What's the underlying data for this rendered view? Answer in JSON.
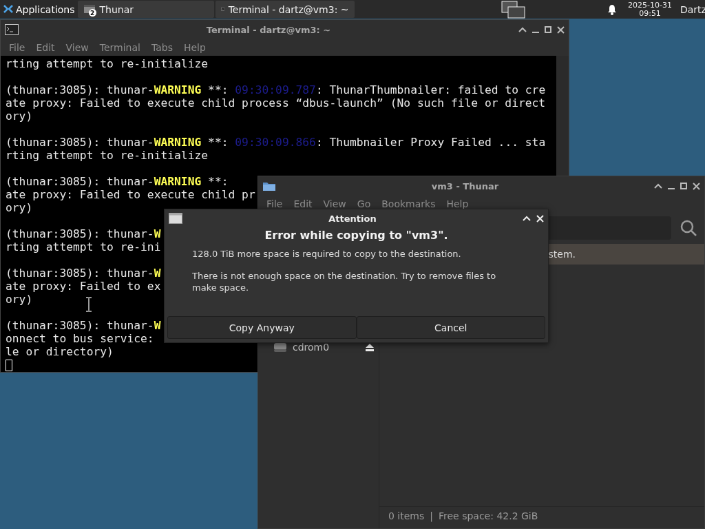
{
  "taskbar": {
    "apps_menu": "Applications",
    "tasks": [
      {
        "label": "Thunar",
        "kind": "file-manager",
        "badge": "2"
      },
      {
        "label": "Terminal - dartz@vm3: ~",
        "kind": "terminal"
      }
    ],
    "date": "2025-10-31",
    "time": "09:51",
    "user": "Dartz"
  },
  "terminal": {
    "title": "Terminal - dartz@vm3: ~",
    "menu": [
      "File",
      "Edit",
      "View",
      "Terminal",
      "Tabs",
      "Help"
    ],
    "entries": [
      {
        "lines": [
          [
            {
              "kind": "plain",
              "text": "rting attempt to re-initialize"
            }
          ]
        ]
      },
      {
        "lines": [
          [
            {
              "kind": "plain",
              "text": "(thunar:3085): thunar-"
            },
            {
              "kind": "warning",
              "text": "WARNING"
            },
            {
              "kind": "plain",
              "text": " **: "
            },
            {
              "kind": "time",
              "text": "09:30:09.787"
            },
            {
              "kind": "plain",
              "text": ": ThunarThumbnailer: failed to cre"
            }
          ],
          [
            {
              "kind": "plain",
              "text": "ate proxy: Failed to execute child process “dbus-launch” (No such file or direct"
            }
          ],
          [
            {
              "kind": "plain",
              "text": "ory)"
            }
          ]
        ]
      },
      {
        "lines": [
          [
            {
              "kind": "plain",
              "text": "(thunar:3085): thunar-"
            },
            {
              "kind": "warning",
              "text": "WARNING"
            },
            {
              "kind": "plain",
              "text": " **: "
            },
            {
              "kind": "time",
              "text": "09:30:09.866"
            },
            {
              "kind": "plain",
              "text": ": Thumbnailer Proxy Failed ... sta"
            }
          ],
          [
            {
              "kind": "plain",
              "text": "rting attempt to re-initialize"
            }
          ]
        ]
      },
      {
        "lines": [
          [
            {
              "kind": "plain",
              "text": "(thunar:3085): thunar-"
            },
            {
              "kind": "warning",
              "text": "WARNING"
            },
            {
              "kind": "plain",
              "text": " **:"
            }
          ],
          [
            {
              "kind": "plain",
              "text": "ate proxy: Failed to execute child pr"
            }
          ],
          [
            {
              "kind": "plain",
              "text": "ory)"
            }
          ]
        ]
      },
      {
        "lines": [
          [
            {
              "kind": "plain",
              "text": "(thunar:3085): thunar-"
            },
            {
              "kind": "warning",
              "text": "W"
            }
          ],
          [
            {
              "kind": "plain",
              "text": "rting attempt to re-ini"
            }
          ]
        ]
      },
      {
        "lines": [
          [
            {
              "kind": "plain",
              "text": "(thunar:3085): thunar-"
            },
            {
              "kind": "warning",
              "text": "W"
            }
          ],
          [
            {
              "kind": "plain",
              "text": "ate proxy: Failed to ex"
            }
          ],
          [
            {
              "kind": "plain",
              "text": "ory)"
            }
          ]
        ]
      },
      {
        "lines": [
          [
            {
              "kind": "plain",
              "text": "(thunar:3085): thunar-"
            },
            {
              "kind": "warning",
              "text": "W"
            }
          ],
          [
            {
              "kind": "plain",
              "text": "onnect to bus service:"
            }
          ],
          [
            {
              "kind": "plain",
              "text": "le or directory)"
            }
          ]
        ]
      }
    ]
  },
  "thunar": {
    "title": "vm3 - Thunar",
    "menu": [
      "File",
      "Edit",
      "View",
      "Go",
      "Bookmarks",
      "Help"
    ],
    "info_bar": "stem.",
    "sidebar": {
      "items": [
        {
          "label": "cdrom0",
          "kind": "optical-drive"
        }
      ]
    },
    "status_bar": {
      "items": "0 items",
      "separator": "|",
      "free_space": "Free space: 42.2 GiB"
    }
  },
  "dialog": {
    "title": "Attention",
    "heading": "Error while copying to \"vm3\".",
    "messages": [
      "128.0 TiB more space is required to copy to the destination.",
      "There is not enough space on the destination. Try to remove files to make space."
    ],
    "buttons": [
      {
        "label": "Copy Anyway"
      },
      {
        "label": "Cancel"
      }
    ]
  }
}
